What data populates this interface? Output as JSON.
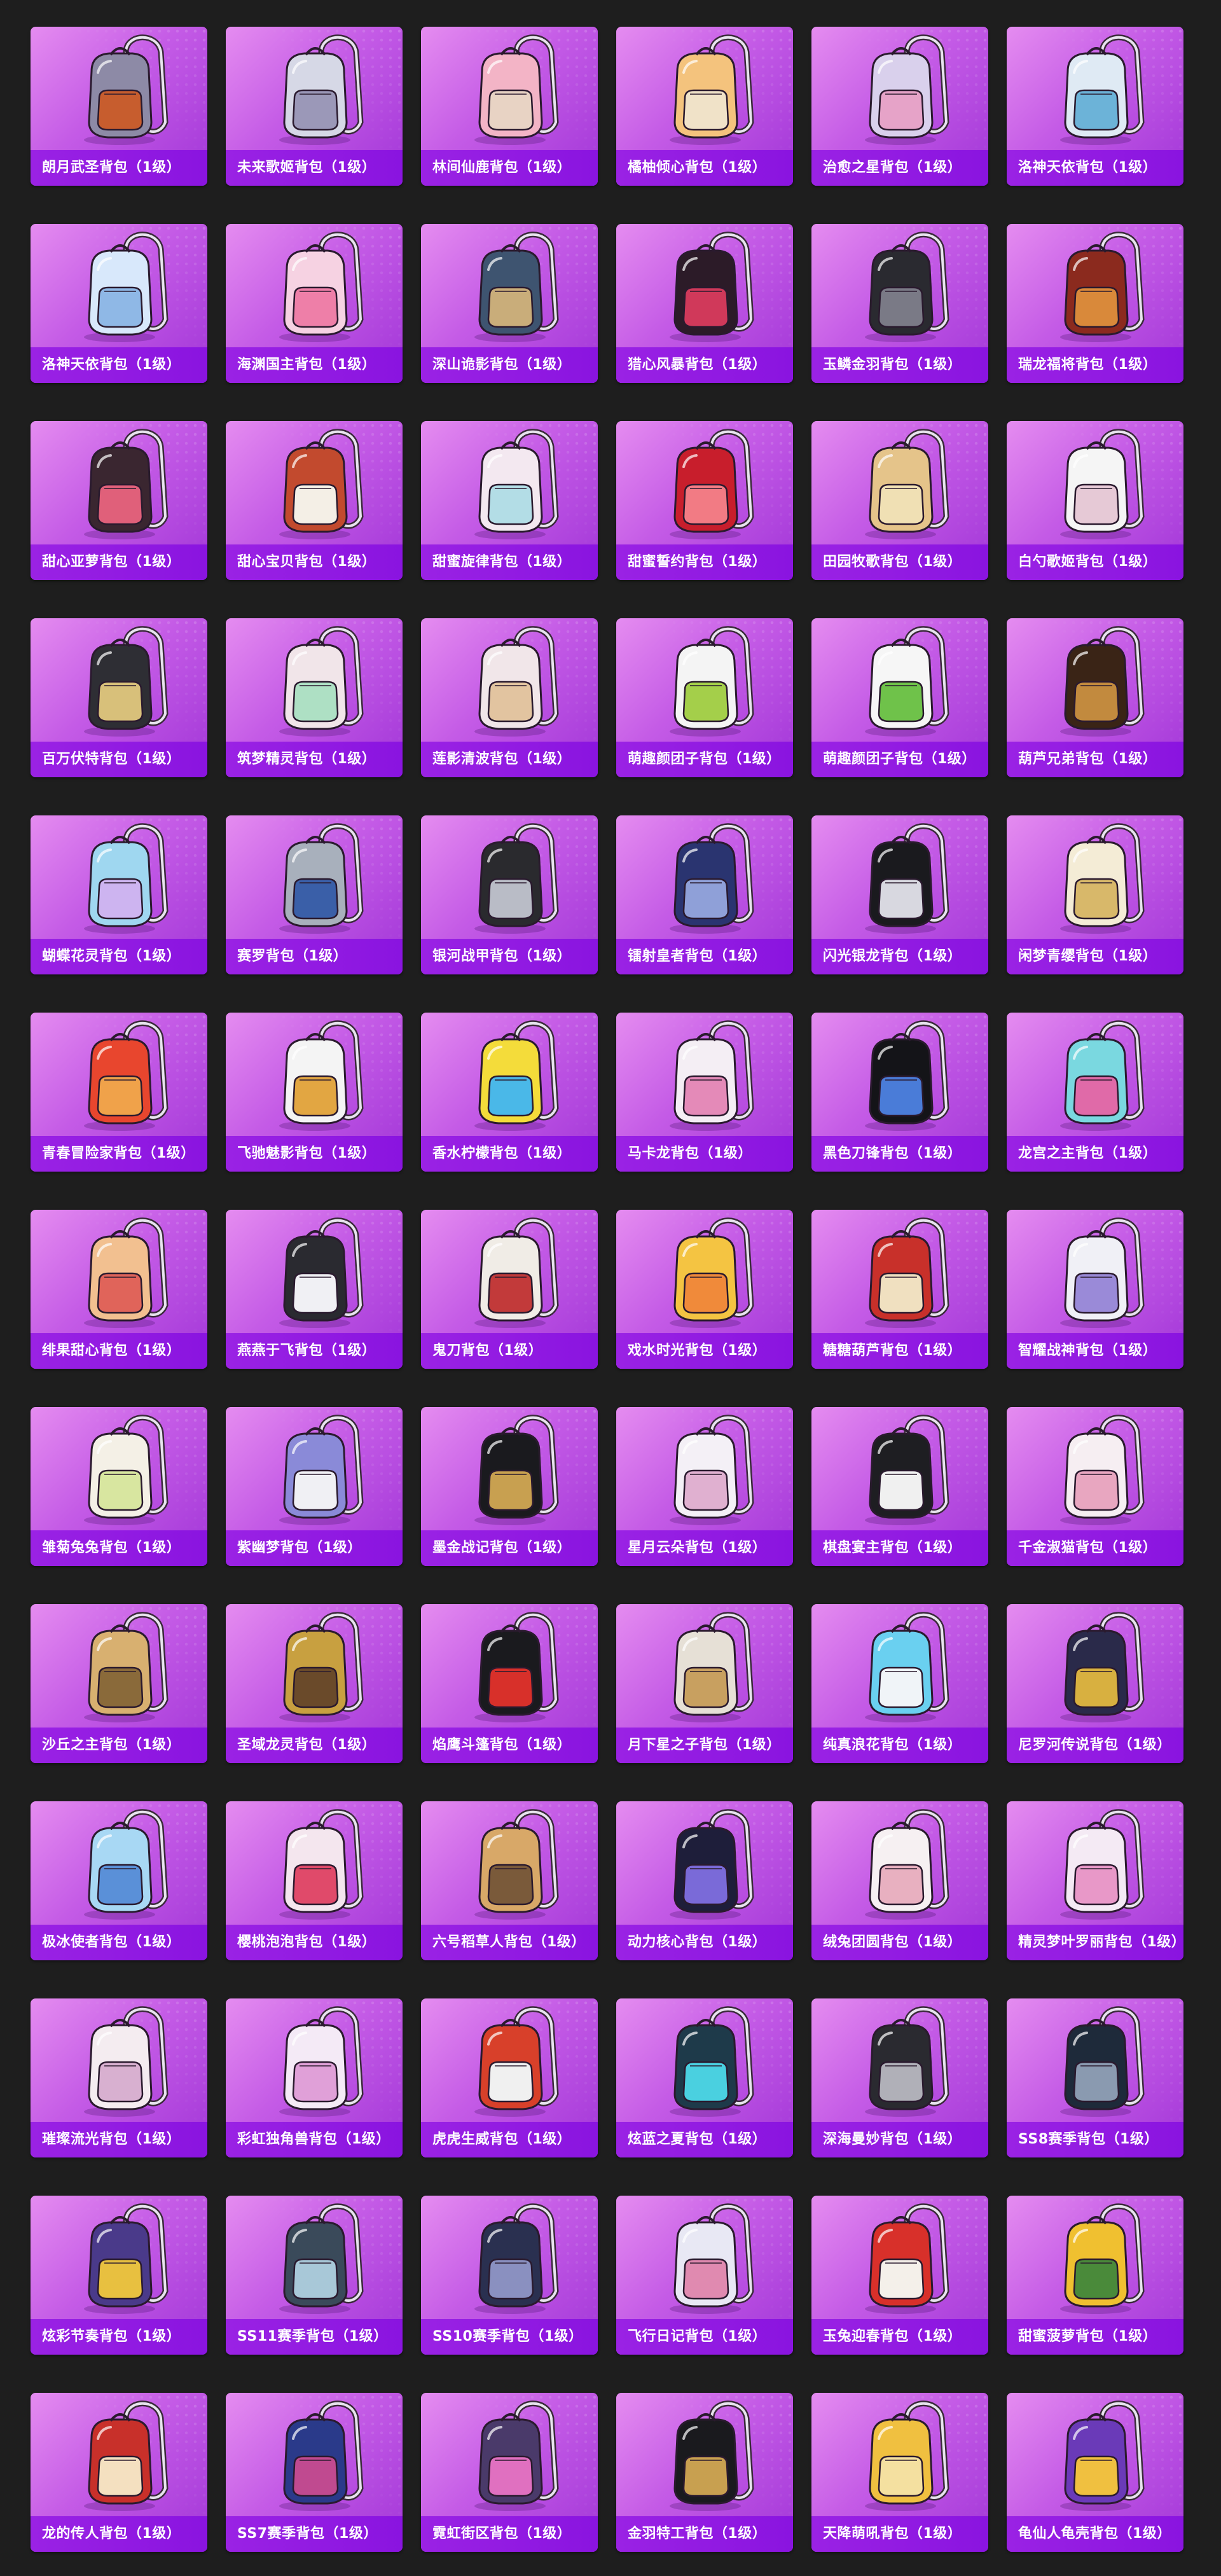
{
  "colors": {
    "page_background": "#1e1e1e",
    "card_gradient_light": "#e58cf0",
    "card_gradient_dark": "#a236d8",
    "label_band": "#9a22e4",
    "label_text": "#ffffff"
  },
  "items": [
    {
      "name": "朗月武圣背包（1级）",
      "icon": "armor-backpack-icon",
      "colors": [
        "#8d8aa6",
        "#c75d2e"
      ]
    },
    {
      "name": "未来歌姬背包（1级）",
      "icon": "white-backpack-icon",
      "colors": [
        "#d6d8e6",
        "#9b98b8"
      ]
    },
    {
      "name": "林间仙鹿背包（1级）",
      "icon": "plush-backpack-icon",
      "colors": [
        "#f3b4c6",
        "#e8d3c4"
      ]
    },
    {
      "name": "橘柚倾心背包（1级）",
      "icon": "orange-backpack-icon",
      "colors": [
        "#f4c37d",
        "#f0e2c8"
      ]
    },
    {
      "name": "治愈之星背包（1级）",
      "icon": "star-backpack-icon",
      "colors": [
        "#d9d0ec",
        "#e6a3c8"
      ]
    },
    {
      "name": "洛神天依背包（1级）",
      "icon": "helmet-backpack-icon",
      "colors": [
        "#dfeaf4",
        "#6cb3d8"
      ]
    },
    {
      "name": "洛神天依背包（1级）",
      "icon": "crystal-backpack-icon",
      "colors": [
        "#d8e8fb",
        "#8fb8e6"
      ]
    },
    {
      "name": "海渊国主背包（1级）",
      "icon": "pink-bunny-backpack-icon",
      "colors": [
        "#f6d2e2",
        "#ee7fa8"
      ]
    },
    {
      "name": "深山诡影背包（1级）",
      "icon": "hiking-backpack-icon",
      "colors": [
        "#3e5470",
        "#c9ad7a"
      ]
    },
    {
      "name": "猎心风暴背包（1级）",
      "icon": "dark-backpack-icon",
      "colors": [
        "#2c1b28",
        "#d0395a"
      ]
    },
    {
      "name": "玉鳞金羽背包（1级）",
      "icon": "handbag-backpack-icon",
      "colors": [
        "#2a2a30",
        "#7a7a86"
      ]
    },
    {
      "name": "瑞龙福将背包（1级）",
      "icon": "dragon-armor-backpack-icon",
      "colors": [
        "#8b2a1e",
        "#d9893a"
      ]
    },
    {
      "name": "甜心亚萝背包（1级）",
      "icon": "cat-backpack-icon",
      "colors": [
        "#3a2630",
        "#e0607a"
      ]
    },
    {
      "name": "甜心宝贝背包（1级）",
      "icon": "cupcake-backpack-icon",
      "colors": [
        "#c24a2e",
        "#f4efe6"
      ]
    },
    {
      "name": "甜蜜旋律背包（1级）",
      "icon": "bunny-backpack-icon",
      "colors": [
        "#f3e8f0",
        "#b3dde6"
      ]
    },
    {
      "name": "甜蜜誓约背包（1级）",
      "icon": "heart-backpack-icon",
      "colors": [
        "#c81e2c",
        "#f27b84"
      ]
    },
    {
      "name": "田园牧歌背包（1级）",
      "icon": "basket-backpack-icon",
      "colors": [
        "#e5c48a",
        "#f0e0b4"
      ]
    },
    {
      "name": "白勺歌姬背包（1级）",
      "icon": "white-bunny-backpack-icon",
      "colors": [
        "#f5f5f5",
        "#e6c9d6"
      ]
    },
    {
      "name": "百万伏特背包（1级）",
      "icon": "tech-backpack-icon",
      "colors": [
        "#2e2e34",
        "#d8c07a"
      ]
    },
    {
      "name": "筑梦精灵背包（1级）",
      "icon": "flower-backpack-icon",
      "colors": [
        "#f1e5e9",
        "#aee0c4"
      ]
    },
    {
      "name": "莲影清波背包（1级）",
      "icon": "dress-backpack-icon",
      "colors": [
        "#f1e6e9",
        "#e2c4a0"
      ]
    },
    {
      "name": "萌趣颜团子背包（1级）",
      "icon": "helmet-ball-backpack-icon",
      "colors": [
        "#f4f4f4",
        "#a4cf4a"
      ]
    },
    {
      "name": "萌趣颜团子背包（1级）",
      "icon": "radish-backpack-icon",
      "colors": [
        "#f6f6f6",
        "#6fc24a"
      ]
    },
    {
      "name": "葫芦兄弟背包（1级）",
      "icon": "gourd-backpack-icon",
      "colors": [
        "#3a2416",
        "#c28a3e"
      ]
    },
    {
      "name": "蝴蝶花灵背包（1级）",
      "icon": "butterfly-backpack-icon",
      "colors": [
        "#9fd7f0",
        "#cdb4f0"
      ]
    },
    {
      "name": "赛罗背包（1级）",
      "icon": "mecha-backpack-icon",
      "colors": [
        "#a8b0bc",
        "#3a5fa8"
      ]
    },
    {
      "name": "银河战甲背包（1级）",
      "icon": "battle-armor-backpack-icon",
      "colors": [
        "#2a2a2e",
        "#b9bcc6"
      ]
    },
    {
      "name": "镭射皇者背包（1级）",
      "icon": "laser-backpack-icon",
      "colors": [
        "#2a3470",
        "#8fa0d8"
      ]
    },
    {
      "name": "闪光银龙背包（1级）",
      "icon": "silver-dragon-backpack-icon",
      "colors": [
        "#1a1a1e",
        "#d8d8e0"
      ]
    },
    {
      "name": "闲梦青缨背包（1级）",
      "icon": "cloud-backpack-icon",
      "colors": [
        "#f4ecd6",
        "#d8b86a"
      ]
    },
    {
      "name": "青春冒险家背包（1级）",
      "icon": "red-dino-backpack-icon",
      "colors": [
        "#e8462e",
        "#f0a24a"
      ]
    },
    {
      "name": "飞驰魅影背包（1级）",
      "icon": "racer-backpack-icon",
      "colors": [
        "#f4f4f4",
        "#e2a642"
      ]
    },
    {
      "name": "香水柠檬背包（1级）",
      "icon": "lemon-backpack-icon",
      "colors": [
        "#f4dc3a",
        "#4ab8e8"
      ]
    },
    {
      "name": "马卡龙背包（1级）",
      "icon": "macaron-backpack-icon",
      "colors": [
        "#f4eef4",
        "#e48ab8"
      ]
    },
    {
      "name": "黑色刀锋背包（1级）",
      "icon": "blade-backpack-icon",
      "colors": [
        "#141418",
        "#4a7cd8"
      ]
    },
    {
      "name": "龙宫之主背包（1级）",
      "icon": "lantern-backpack-icon",
      "colors": [
        "#7ad8e0",
        "#e06aa8"
      ]
    },
    {
      "name": "绯果甜心背包（1级）",
      "icon": "peach-backpack-icon",
      "colors": [
        "#f2c090",
        "#e0645a"
      ]
    },
    {
      "name": "燕燕于飞背包（1级）",
      "icon": "swallow-backpack-icon",
      "colors": [
        "#2a2a30",
        "#f0f0f4"
      ]
    },
    {
      "name": "鬼刀背包（1级）",
      "icon": "ghost-blade-backpack-icon",
      "colors": [
        "#f0ece6",
        "#c23a3a"
      ]
    },
    {
      "name": "戏水时光背包（1级）",
      "icon": "duck-backpack-icon",
      "colors": [
        "#f4c442",
        "#f08a3a"
      ]
    },
    {
      "name": "糖糖葫芦背包（1级）",
      "icon": "candied-fruit-backpack-icon",
      "colors": [
        "#c8302a",
        "#f0e0c0"
      ]
    },
    {
      "name": "智耀战神背包（1级）",
      "icon": "orb-backpack-icon",
      "colors": [
        "#f0f0f6",
        "#9a8ad8"
      ]
    },
    {
      "name": "雏菊兔兔背包（1级）",
      "icon": "daisy-bunny-backpack-icon",
      "colors": [
        "#f4f0e6",
        "#d8e6a0"
      ]
    },
    {
      "name": "紫幽梦背包（1级）",
      "icon": "purple-bunny-backpack-icon",
      "colors": [
        "#8a8ad8",
        "#f0f0f4"
      ]
    },
    {
      "name": "墨金战记背包（1级）",
      "icon": "ink-gold-backpack-icon",
      "colors": [
        "#1a1a1e",
        "#c8a050"
      ]
    },
    {
      "name": "星月云朵背包（1级）",
      "icon": "cloud-bunny-backpack-icon",
      "colors": [
        "#f4f0f6",
        "#e0b0d0"
      ]
    },
    {
      "name": "棋盘宴主背包（1级）",
      "icon": "chess-backpack-icon",
      "colors": [
        "#1e1e22",
        "#f0f0f0"
      ]
    },
    {
      "name": "千金淑猫背包（1级）",
      "icon": "lady-cat-backpack-icon",
      "colors": [
        "#f6eef2",
        "#e8a6c0"
      ]
    },
    {
      "name": "沙丘之主背包（1级）",
      "icon": "dune-backpack-icon",
      "colors": [
        "#d8b070",
        "#8a6a3a"
      ]
    },
    {
      "name": "圣域龙灵背包（1级）",
      "icon": "dragon-spirit-backpack-icon",
      "colors": [
        "#c8a040",
        "#6a4a2a"
      ]
    },
    {
      "name": "焰鹰斗篷背包（1级）",
      "icon": "flame-cape-backpack-icon",
      "colors": [
        "#1a1a1e",
        "#d8302a"
      ]
    },
    {
      "name": "月下星之子背包（1级）",
      "icon": "moon-star-backpack-icon",
      "colors": [
        "#e6e0d6",
        "#c8a060"
      ]
    },
    {
      "name": "纯真浪花背包（1级）",
      "icon": "wave-backpack-icon",
      "colors": [
        "#6ad0f0",
        "#f0f4f8"
      ]
    },
    {
      "name": "尼罗河传说背包（1级）",
      "icon": "pharaoh-backpack-icon",
      "colors": [
        "#2a2a4a",
        "#d8b040"
      ]
    },
    {
      "name": "极冰使者背包（1级）",
      "icon": "ice-crystal-backpack-icon",
      "colors": [
        "#a8d8f4",
        "#5a90d8"
      ]
    },
    {
      "name": "樱桃泡泡背包（1级）",
      "icon": "cherry-backpack-icon",
      "colors": [
        "#f4e6ee",
        "#e04a6a"
      ]
    },
    {
      "name": "六号稻草人背包（1级）",
      "icon": "scarecrow-backpack-icon",
      "colors": [
        "#d8a868",
        "#7a5a3a"
      ]
    },
    {
      "name": "动力核心背包（1级）",
      "icon": "power-core-backpack-icon",
      "colors": [
        "#1e1e3a",
        "#7a6ad8"
      ]
    },
    {
      "name": "绒兔团圆背包（1级）",
      "icon": "fluffy-bunny-backpack-icon",
      "colors": [
        "#f6f0f2",
        "#e8b0c0"
      ]
    },
    {
      "name": "精灵梦叶罗丽背包（1级）",
      "icon": "fairy-heart-backpack-icon",
      "colors": [
        "#f4eaf4",
        "#e898c8"
      ]
    },
    {
      "name": "璀璨流光背包（1级）",
      "icon": "bow-backpack-icon",
      "colors": [
        "#f4ecf0",
        "#d8b0d0"
      ]
    },
    {
      "name": "彩虹独角兽背包（1级）",
      "icon": "unicorn-backpack-icon",
      "colors": [
        "#f4eaf6",
        "#e0a0d8"
      ]
    },
    {
      "name": "虎虎生威背包（1级）",
      "icon": "tiger-backpack-icon",
      "colors": [
        "#d8402a",
        "#f0f0f0"
      ]
    },
    {
      "name": "炫蓝之夏背包（1级）",
      "icon": "summer-backpack-icon",
      "colors": [
        "#1e3a4a",
        "#4ad0e0"
      ]
    },
    {
      "name": "深海曼妙背包（1级）",
      "icon": "deep-sea-backpack-icon",
      "colors": [
        "#2a2a30",
        "#b0b0b8"
      ]
    },
    {
      "name": "SS8赛季背包（1级）",
      "icon": "ss8-backpack-icon",
      "colors": [
        "#1e2a3a",
        "#8a9ab0"
      ]
    },
    {
      "name": "炫彩节奏背包（1级）",
      "icon": "rhythm-backpack-icon",
      "colors": [
        "#4a3a8a",
        "#e8c040"
      ]
    },
    {
      "name": "SS11赛季背包（1级）",
      "icon": "ss11-backpack-icon",
      "colors": [
        "#3a4a5a",
        "#a8c8d8"
      ]
    },
    {
      "name": "SS10赛季背包（1级）",
      "icon": "ss10-backpack-icon",
      "colors": [
        "#2a3050",
        "#8a90c0"
      ]
    },
    {
      "name": "飞行日记背包（1级）",
      "icon": "flight-diary-backpack-icon",
      "colors": [
        "#e8e8f4",
        "#e08ab0"
      ]
    },
    {
      "name": "玉兔迎春背包（1级）",
      "icon": "jade-rabbit-backpack-icon",
      "colors": [
        "#d8302a",
        "#f4f0ea"
      ]
    },
    {
      "name": "甜蜜菠萝背包（1级）",
      "icon": "pineapple-backpack-icon",
      "colors": [
        "#f0c030",
        "#4a8a3a"
      ]
    },
    {
      "name": "龙的传人背包（1级）",
      "icon": "dragon-heir-backpack-icon",
      "colors": [
        "#c8302a",
        "#f4e0c0"
      ]
    },
    {
      "name": "SS7赛季背包（1级）",
      "icon": "ss7-backpack-icon",
      "colors": [
        "#2a3a8a",
        "#c04a90"
      ]
    },
    {
      "name": "霓虹街区背包（1级）",
      "icon": "neon-street-backpack-icon",
      "colors": [
        "#4a3a6a",
        "#e070c0"
      ]
    },
    {
      "name": "金羽特工背包（1级）",
      "icon": "agent-backpack-icon",
      "colors": [
        "#1a1a1e",
        "#c8a050"
      ]
    },
    {
      "name": "天降萌吼背包（1级）",
      "icon": "cute-roar-backpack-icon",
      "colors": [
        "#f0c040",
        "#f4e0a0"
      ]
    },
    {
      "name": "龟仙人龟壳背包（1级）",
      "icon": "turtle-shell-backpack-icon",
      "colors": [
        "#6a3ab8",
        "#f0c040"
      ]
    }
  ]
}
